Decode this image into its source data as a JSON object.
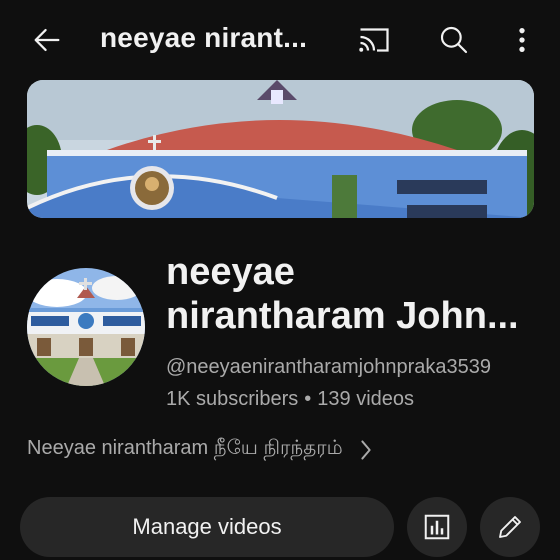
{
  "header": {
    "title": "neeyae nirant...",
    "icons": [
      "back-arrow-icon",
      "cast-icon",
      "search-icon",
      "more-vert-icon"
    ]
  },
  "channel": {
    "name_line1": "neeyae",
    "name_line2": "nirantharam John...",
    "handle": "@neeyaenirantharamjohnpraka3539",
    "subscribers": "1K subscribers",
    "separator": "•",
    "videos": "139 videos",
    "description": "Neeyae nirantharam  நீயே நிரந்தரம்"
  },
  "actions": {
    "manage_label": "Manage videos",
    "icons": [
      "analytics-icon",
      "edit-pencil-icon"
    ]
  },
  "colors": {
    "background": "#0f0f0f",
    "text": "#f1f1f1",
    "secondary_text": "#aaaaaa",
    "button_bg": "#272727"
  }
}
